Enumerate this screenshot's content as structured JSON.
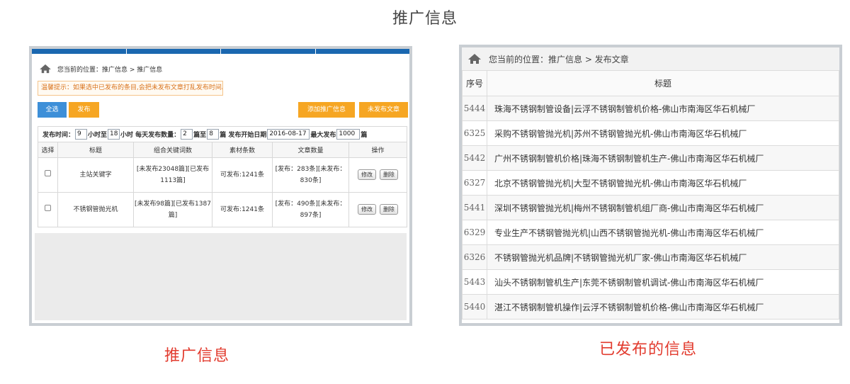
{
  "page_title": "推广信息",
  "left": {
    "breadcrumb": "您当前的位置：推广信息 > 推广信息",
    "tip": "温馨提示：如果选中已发布的条目,会把未发布文章打乱发布时间。",
    "buttons": {
      "select_all": "全选",
      "publish": "发布",
      "add_promo": "添加推广信息",
      "unpublished": "未发布文章"
    },
    "filters": {
      "publish_time_label": "发布时间：",
      "hour_from": "9",
      "hour_sep": "小时至",
      "hour_to": "18",
      "daily_label": "小时 每天发布数量：",
      "daily_from": "2",
      "daily_sep": "篇至",
      "daily_to": "8",
      "start_label": "篇 发布开始日期",
      "start_date": "2016-08-17",
      "max_label": "最大发布",
      "max_value": "1000",
      "max_unit": "篇"
    },
    "table": {
      "headers": [
        "选择",
        "标题",
        "组合关键词数",
        "素材条数",
        "文章数量",
        "操作"
      ],
      "rows": [
        {
          "title": "主站关键字",
          "keywords": "[未发布23048篇][已发布1113篇]",
          "material": "可发布:1241条",
          "articles": "[发布：283条][未发布：830条]"
        },
        {
          "title": "不锈钢管抛光机",
          "keywords": "[未发布98篇][已发布1387篇]",
          "material": "可发布:1241条",
          "articles": "[发布：490条][未发布：897条]"
        }
      ],
      "edit_label": "修改",
      "delete_label": "删除"
    },
    "caption": "推广信息"
  },
  "right": {
    "breadcrumb": "您当前的位置：推广信息 > 发布文章",
    "headers": [
      "序号",
      "标题"
    ],
    "rows": [
      {
        "id": "5444",
        "title": "珠海不锈钢制管设备|云浮不锈钢制管机价格-佛山市南海区华石机械厂"
      },
      {
        "id": "6325",
        "title": "采购不锈钢管抛光机|苏州不锈钢管抛光机-佛山市南海区华石机械厂"
      },
      {
        "id": "5442",
        "title": "广州不锈钢制管机价格|珠海不锈钢制管机生产-佛山市南海区华石机械厂"
      },
      {
        "id": "6327",
        "title": "北京不锈钢管抛光机|大型不锈钢管抛光机-佛山市南海区华石机械厂"
      },
      {
        "id": "5441",
        "title": "深圳不锈钢管抛光机|梅州不锈钢制管机组厂商-佛山市南海区华石机械厂"
      },
      {
        "id": "6329",
        "title": "专业生产不锈钢管抛光机|山西不锈钢管抛光机-佛山市南海区华石机械厂"
      },
      {
        "id": "6326",
        "title": "不锈钢管抛光机品牌|不锈钢管抛光机厂家-佛山市南海区华石机械厂"
      },
      {
        "id": "5443",
        "title": "汕头不锈钢制管机生产|东莞不锈钢制管机调试-佛山市南海区华石机械厂"
      },
      {
        "id": "5440",
        "title": "湛江不锈钢制管机操作|云浮不锈钢制管机价格-佛山市南海区华石机械厂"
      }
    ],
    "caption": "已发布的信息"
  },
  "icons": {
    "home": "home-icon",
    "checkbox": "checkbox-icon"
  },
  "colors": {
    "accent_blue": "#3d8fd8",
    "accent_orange": "#f6a623",
    "caption_red": "#e23b2e",
    "top_bar": "#1a67b0"
  }
}
